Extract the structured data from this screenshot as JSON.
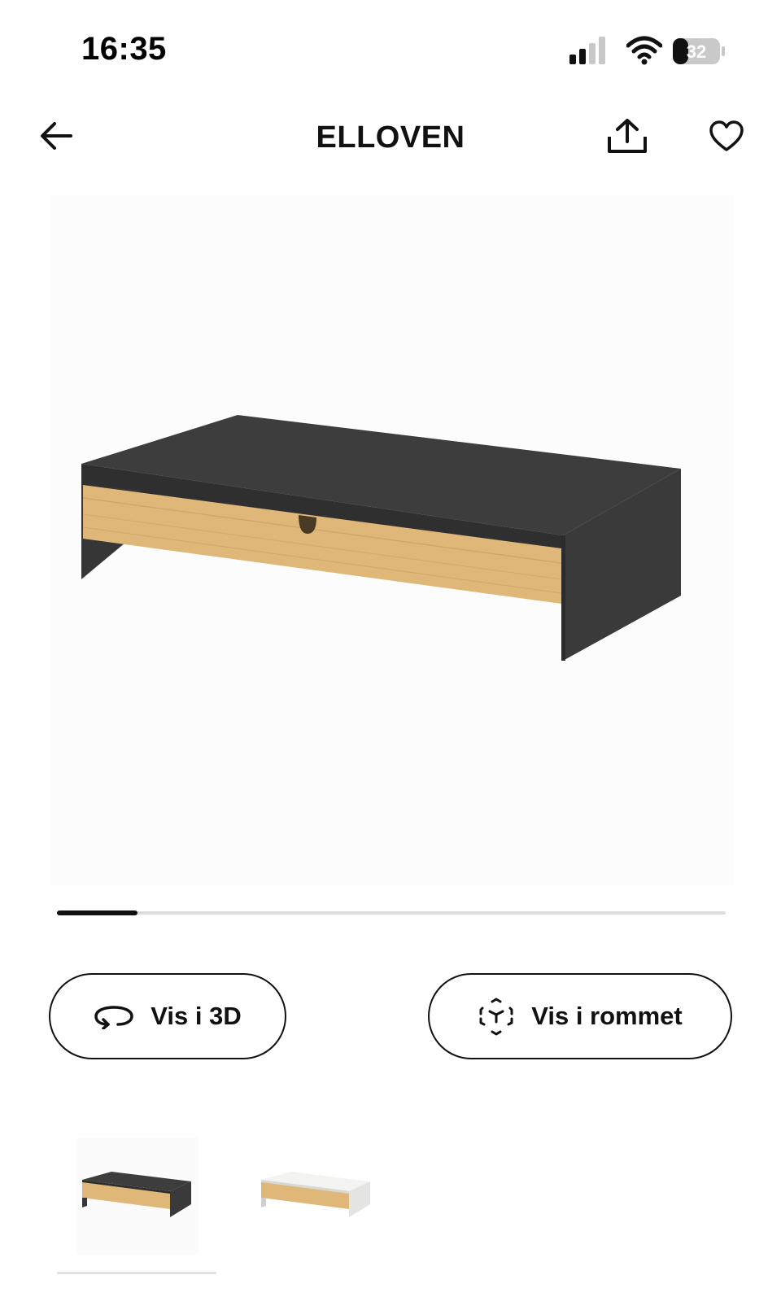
{
  "status_bar": {
    "time": "16:35",
    "battery_level": "32",
    "signal_icon": "cellular-signal-icon",
    "wifi_icon": "wifi-icon"
  },
  "nav": {
    "title": "ELLOVEN",
    "back_icon": "arrow-left-icon",
    "share_icon": "share-icon",
    "favorite_icon": "heart-icon"
  },
  "gallery": {
    "image_progress": 0.12
  },
  "actions": {
    "view_3d_label": "Vis i 3D",
    "view_3d_icon": "rotate-3d-icon",
    "view_room_label": "Vis i rommet",
    "view_room_icon": "ar-cube-icon"
  },
  "variants": [
    {
      "name": "anthracite-bamboo",
      "selected": true
    },
    {
      "name": "white-bamboo",
      "selected": false
    }
  ],
  "colors": {
    "text": "#111111",
    "anthracite": "#3f3f3f",
    "bamboo": "#dfb779",
    "white_variant": "#ececea"
  }
}
